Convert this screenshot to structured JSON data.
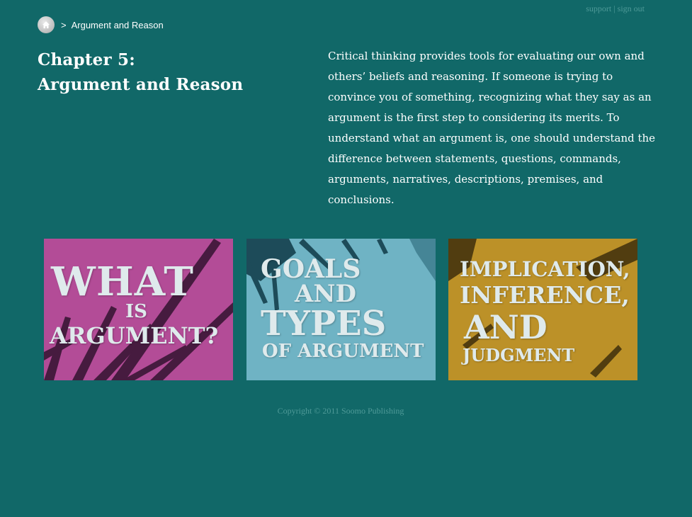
{
  "header": {
    "support_label": "support",
    "separator": "|",
    "signout_label": "sign out"
  },
  "breadcrumb": {
    "home_icon": "home-icon",
    "separator": ">",
    "current": "Argument and Reason"
  },
  "chapter": {
    "line1": "Chapter 5:",
    "line2": "Argument and Reason"
  },
  "intro": "Critical thinking provides tools for evaluating our own and others’ beliefs and reasoning. If someone is trying to convince you of something, recognizing what they say as an argument is the first step to considering its merits. To understand what an argument is, one should understand the difference between statements, questions, commands, arguments, narratives, descriptions, premises, and conclusions.",
  "tiles": [
    {
      "lines": [
        "WHAT",
        "IS",
        "ARGUMENT?"
      ],
      "color": "#b34c97"
    },
    {
      "lines": [
        "GOALS",
        "AND",
        "TYPES",
        "OF ARGUMENT"
      ],
      "color": "#6fb3c4"
    },
    {
      "lines": [
        "IMPLICATION,",
        "INFERENCE,",
        "AND",
        "JUDGMENT"
      ],
      "color": "#bc9128"
    }
  ],
  "footer": {
    "copyright": "Copyright © 2011 Soomo Publishing"
  },
  "colors": {
    "background": "#116868",
    "muted_link": "#4f9a98"
  }
}
